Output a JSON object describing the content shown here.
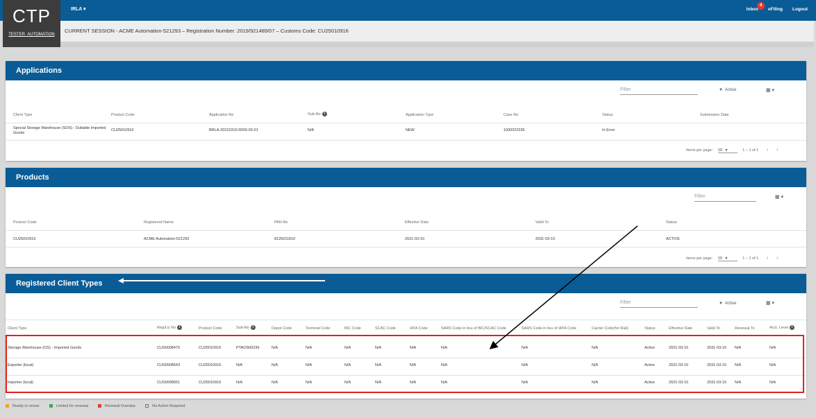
{
  "header": {
    "logo_big": "CTP",
    "logo_small": "TESTER_AUTOMATION",
    "env": "IRLA ▾",
    "inbox": "Inbox",
    "inbox_count": "4",
    "efiling": "eFiling",
    "logout": "Logout",
    "session": "CURRENT SESSION - ACME Automation-521293 – Registration Number: 2019/921489/07 – Customs Code: CU25010916"
  },
  "applications": {
    "title": "Applications",
    "filter_placeholder": "Filter",
    "active_label": "Active",
    "columns": [
      "Client Type",
      "Product Code",
      "Application No",
      "Sub-No",
      "Application Type",
      "Case No",
      "Status",
      "Submission Date"
    ],
    "row": {
      "client_type_1": "Special Storage Warehouse (SOS) - Dutiable Imported",
      "client_type_2": "Goods",
      "product_code": "CU25010916",
      "application_no": "BRLA-20210310-0003-03-01",
      "sub_no": "N/A",
      "application_type": "NEW",
      "case_no": "1000022335",
      "status": "In Error",
      "submission_date": ""
    },
    "pager": {
      "label": "Items per page:",
      "value": "10",
      "range": "1 – 1 of 1"
    }
  },
  "products": {
    "title": "Products",
    "filter_placeholder": "Filter",
    "columns": [
      "Product Code",
      "Registered Name",
      "PAN No",
      "Effective Date",
      "Valid To",
      "Status"
    ],
    "row": [
      "CU25010916",
      "ACME Automation-521293",
      "8125011810",
      "2021-03-10",
      "2031-03-10",
      "ACTIVE"
    ],
    "pager": {
      "label": "Items per page:",
      "value": "10",
      "range": "1 – 1 of 1"
    }
  },
  "client_types": {
    "title": "Registered Client Types",
    "filter_placeholder": "Filter",
    "active_label": "Active",
    "columns": [
      "Client Type",
      "Reg/Lic No",
      "Product Code",
      "Sub-No",
      "Depot Code",
      "Terminal Code",
      "BIC Code",
      "SCAC Code",
      "IATA Code",
      "SARS Code in lieu of BIC/SCAC Code",
      "SARS Code in lieu of IATA Code",
      "Carrier Code(for Rail)",
      "Status",
      "Effective Date",
      "Valid To",
      "Renewal To",
      "Acct. Level"
    ],
    "rows": [
      [
        "Storage Warehouse (OS) - Imported Goods",
        "CUS0008475",
        "CU25010916",
        "PTAOS00236",
        "N/A",
        "N/A",
        "N/A",
        "N/A",
        "N/A",
        "N/A",
        "N/A",
        "N/A",
        "Active",
        "2021-03-15",
        "2031-03-15",
        "N/A",
        "N/A"
      ],
      [
        "Exporter (local)",
        "CUS0008543",
        "CU25010916",
        "N/A",
        "N/A",
        "N/A",
        "N/A",
        "N/A",
        "N/A",
        "N/A",
        "N/A",
        "N/A",
        "Active",
        "2021-03-15",
        "2031-03-15",
        "N/A",
        "N/A"
      ],
      [
        "Importer (local)",
        "CUS0008551",
        "CU25010916",
        "N/A",
        "N/A",
        "N/A",
        "N/A",
        "N/A",
        "N/A",
        "N/A",
        "N/A",
        "N/A",
        "Active",
        "2021-03-15",
        "2031-03-15",
        "N/A",
        "N/A"
      ]
    ]
  },
  "legend": [
    "Ready to renew",
    "Limited for renewal",
    "Renewal Overdue",
    "No Action Required"
  ],
  "colors": {
    "header_blue": "#0a5c96",
    "highlight_red": "#e02020",
    "legend_orange": "#f0a030",
    "legend_green": "#3aa757",
    "legend_red": "#e53935"
  }
}
